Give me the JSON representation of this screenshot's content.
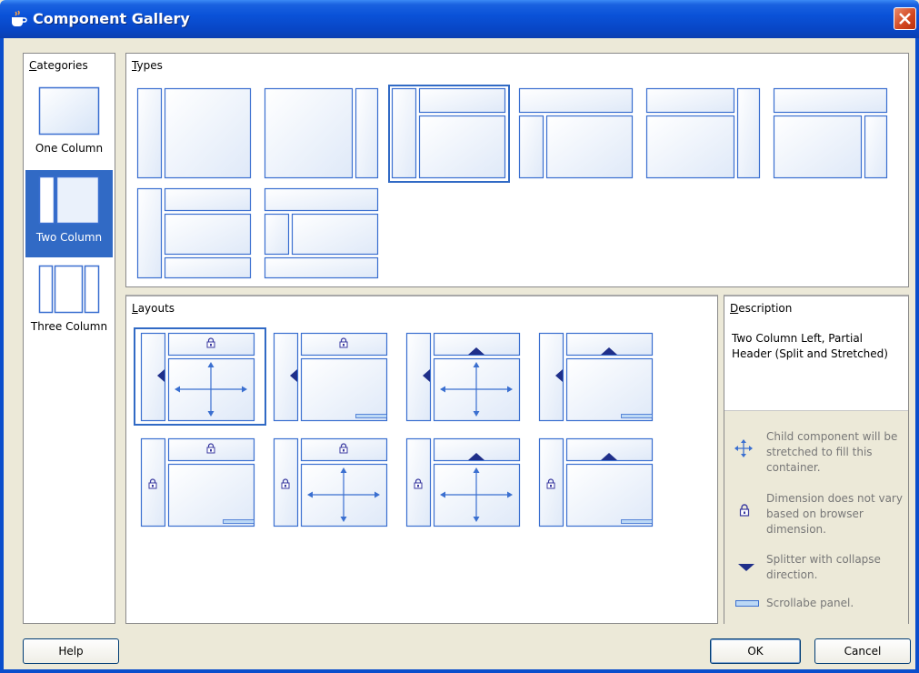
{
  "window": {
    "title": "Component Gallery"
  },
  "categories": {
    "header": "Categories",
    "items": [
      {
        "label": "One Column",
        "selected": false
      },
      {
        "label": "Two Column",
        "selected": true
      },
      {
        "label": "Three Column",
        "selected": false
      }
    ]
  },
  "types": {
    "header": "Types"
  },
  "layouts": {
    "header": "Layouts"
  },
  "description": {
    "header": "Description",
    "text": "Two Column Left, Partial Header (Split and Stretched)",
    "legend": [
      {
        "icon": "stretch-arrows-icon",
        "text": "Child component will be stretched to fill this container."
      },
      {
        "icon": "lock-icon",
        "text": "Dimension does not vary based on browser dimension."
      },
      {
        "icon": "splitter-triangle-icon",
        "text": "Splitter with collapse direction."
      },
      {
        "icon": "scrollable-panel-icon",
        "text": "Scrollabe panel."
      }
    ]
  },
  "buttons": {
    "help": "Help",
    "ok": "OK",
    "cancel": "Cancel"
  },
  "colors": {
    "accent": "#316ac5",
    "titlebar": "#0a52d8",
    "diagram_line": "#3a6fd0"
  }
}
